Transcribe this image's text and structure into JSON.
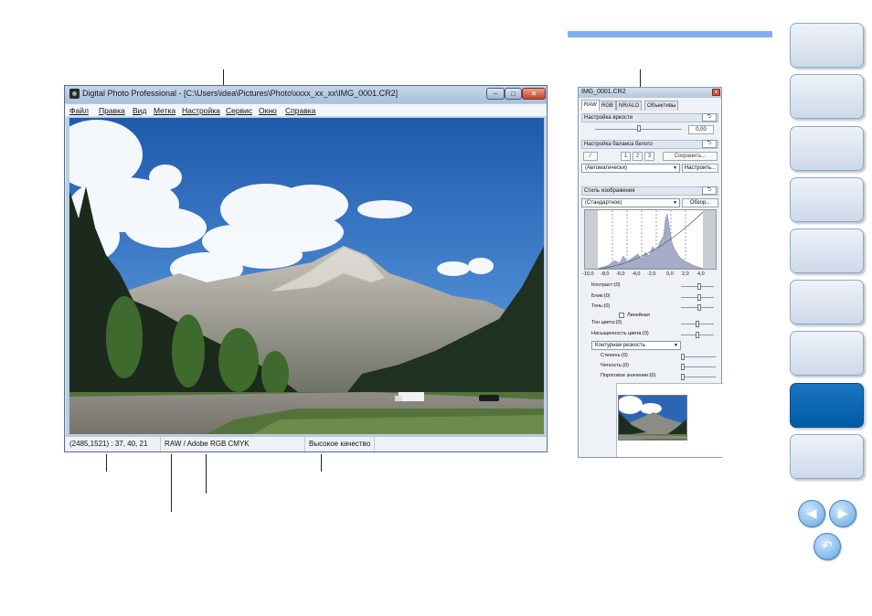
{
  "main_window": {
    "title": "Digital Photo Professional - [C:\\Users\\idea\\Pictures\\Photo\\xxxx_xx_xx\\IMG_0001.CR2]",
    "controls": {
      "minimize": "–",
      "maximize": "□",
      "close": "✕"
    },
    "menu": [
      "Файл",
      "Правка",
      "Вид",
      "Метка",
      "Настройка",
      "Сервис",
      "Окно",
      "Справка"
    ],
    "status": {
      "coords": "(2485,1521) :  37, 40, 21",
      "color": "RAW / Adobe RGB CMYK",
      "quality": "Высокое качество"
    }
  },
  "tool_palette": {
    "title": "IMG_0001.CR2",
    "close": "x",
    "tabs": [
      "RAW",
      "RGB",
      "NR/ALO",
      "Объективы"
    ],
    "brightness": {
      "header": "Настройка яркости",
      "value": "0,00",
      "level": 0.5
    },
    "white_balance": {
      "header": "Настройка баланса белого",
      "numbers": [
        "1",
        "2",
        "3"
      ],
      "save": "Сохранить...",
      "mode": "(Автоматически)",
      "tune": "Настроить..."
    },
    "picture_style": {
      "header": "Стиль изображения",
      "style": "(Стандартное)",
      "browse": "Обзор...",
      "histogram_ticks": [
        "-10,0",
        "-8,0",
        "-6,0",
        "-4,0",
        "-2,0",
        "0,0",
        "2,0",
        "4,0"
      ],
      "sliders": [
        {
          "label": "Контраст:(0)",
          "level": 0.55
        },
        {
          "label": "Блик:(0)",
          "level": 0.55
        },
        {
          "label": "Тень:(0)",
          "level": 0.55
        }
      ],
      "linear_label": "Линейная",
      "color_sliders": [
        {
          "label": "Тон цвета:(0)",
          "level": 0.5
        },
        {
          "label": "Насыщенность цвета:(0)",
          "level": 0.5
        }
      ],
      "sharpness_mode": "Контурная резкость",
      "sharpness_sliders": [
        {
          "label": "Степень:(0)",
          "level": 0.0
        },
        {
          "label": "Четкость:(0)",
          "level": 0.0
        },
        {
          "label": "Пороговое значение:(0)",
          "level": 0.0
        }
      ]
    },
    "undo_glyph": "⮌"
  },
  "colors": {
    "accent_bar": "#7fb1ef",
    "nav_active": "#005ba5",
    "nav_inactive": "#dde6f2"
  },
  "navigation": {
    "prev_icon": "◀",
    "next_icon": "▶",
    "back_icon": "↶"
  }
}
